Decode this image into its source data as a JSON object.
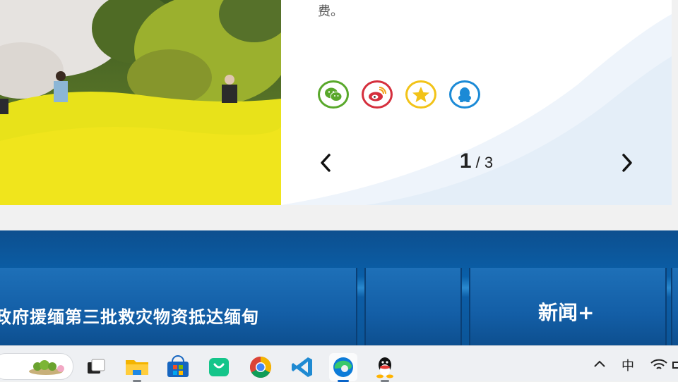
{
  "article": {
    "snippet_tail": "费。"
  },
  "share": {
    "buttons": [
      {
        "name": "wechat",
        "icon": "wechat-icon",
        "color": "#59a82b"
      },
      {
        "name": "weibo",
        "icon": "weibo-icon",
        "color": "#d52f3d"
      },
      {
        "name": "qzone",
        "icon": "qzone-star-icon",
        "color": "#f2c318"
      },
      {
        "name": "qq",
        "icon": "qq-penguin-icon",
        "color": "#1b8ad6"
      }
    ]
  },
  "pager": {
    "current": "1",
    "separator_total": " / 3"
  },
  "banner": {
    "headline": "政府援缅第三批救灾物资抵达缅甸",
    "section_link": "新闻+"
  },
  "taskbar": {
    "apps": [
      "task-view",
      "file-explorer",
      "microsoft-store",
      "wechat-store",
      "chrome",
      "vscode",
      "edge",
      "qq"
    ],
    "active_app": "edge",
    "tray": {
      "ime_label": "中",
      "overflow_icon": "chevron-up-icon",
      "wifi_icon": "wifi-icon"
    }
  },
  "colors": {
    "banner_blue": "#0a5fa8",
    "active_indicator": "#0a64c8"
  }
}
